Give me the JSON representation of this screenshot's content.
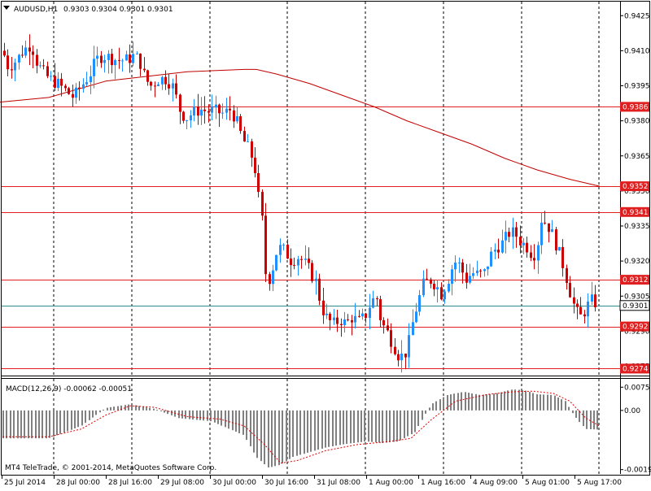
{
  "header": {
    "symbol_timeframe": "AUDUSD,H1",
    "ohlc": "0.9303 0.9304 0.9301 0.9301"
  },
  "footer": {
    "copyright": "MT4 TeleTrade, © 2001-2014, MetaQuotes Software Corp."
  },
  "colors": {
    "background": "#ffffff",
    "bull": "#1e90ff",
    "bear": "#cc0000",
    "level_line": "#e02020",
    "ma_line": "#c00000",
    "current_line": "#2e8b8b",
    "macd_hist": "#808080",
    "macd_signal": "#e00000",
    "grid_separator": "#000000"
  },
  "chart_data": [
    {
      "type": "candlestick",
      "title": "AUDUSD,H1",
      "ylim": [
        0.9271,
        0.9431
      ],
      "ticks": [
        "0.9425",
        "0.9410",
        "0.9395",
        "0.9380",
        "0.9365",
        "0.9350",
        "0.9335",
        "0.9320",
        "0.9305",
        "0.9290",
        "0.9275"
      ],
      "time_labels": [
        "25 Jul 2014",
        "28 Jul 00:00",
        "28 Jul 16:00",
        "29 Jul 08:00",
        "30 Jul 00:00",
        "30 Jul 16:00",
        "31 Jul 08:00",
        "1 Aug 00:00",
        "1 Aug 16:00",
        "4 Aug 09:00",
        "5 Aug 01:00",
        "5 Aug 17:00"
      ],
      "levels": [
        "0.9386",
        "0.9352",
        "0.9341",
        "0.9312",
        "0.9292",
        "0.9274"
      ],
      "current_price": "0.9301",
      "moving_average": [
        [
          0,
          0.9388
        ],
        [
          60,
          0.939
        ],
        [
          130,
          0.9397
        ],
        [
          180,
          0.9399
        ],
        [
          230,
          0.9401
        ],
        [
          300,
          0.9402
        ],
        [
          315,
          0.9402
        ],
        [
          340,
          0.94
        ],
        [
          380,
          0.9396
        ],
        [
          420,
          0.9391
        ],
        [
          460,
          0.9386
        ],
        [
          500,
          0.938
        ],
        [
          540,
          0.9375
        ],
        [
          580,
          0.937
        ],
        [
          620,
          0.9364
        ],
        [
          660,
          0.9359
        ],
        [
          700,
          0.9355
        ],
        [
          737,
          0.9352
        ]
      ],
      "candle_path": [
        [
          3,
          0.941
        ],
        [
          10,
          0.9403
        ],
        [
          20,
          0.9406
        ],
        [
          28,
          0.941
        ],
        [
          38,
          0.9413
        ],
        [
          45,
          0.9405
        ],
        [
          52,
          0.9401
        ],
        [
          60,
          0.9398
        ],
        [
          70,
          0.9396
        ],
        [
          80,
          0.9393
        ],
        [
          90,
          0.939
        ],
        [
          100,
          0.9395
        ],
        [
          110,
          0.94
        ],
        [
          118,
          0.9406
        ],
        [
          125,
          0.9408
        ],
        [
          135,
          0.9407
        ],
        [
          145,
          0.9406
        ],
        [
          155,
          0.9406
        ],
        [
          165,
          0.9408
        ],
        [
          172,
          0.9405
        ],
        [
          178,
          0.9398
        ],
        [
          185,
          0.9395
        ],
        [
          195,
          0.9398
        ],
        [
          205,
          0.9398
        ],
        [
          213,
          0.9394
        ],
        [
          220,
          0.9385
        ],
        [
          228,
          0.9381
        ],
        [
          235,
          0.9383
        ],
        [
          245,
          0.9385
        ],
        [
          255,
          0.9384
        ],
        [
          265,
          0.9384
        ],
        [
          275,
          0.9383
        ],
        [
          283,
          0.9385
        ],
        [
          290,
          0.938
        ],
        [
          298,
          0.9372
        ],
        [
          305,
          0.9368
        ],
        [
          312,
          0.9362
        ],
        [
          317,
          0.9348
        ],
        [
          322,
          0.9337
        ],
        [
          326,
          0.9315
        ],
        [
          332,
          0.9312
        ],
        [
          338,
          0.9323
        ],
        [
          345,
          0.9326
        ],
        [
          352,
          0.9323
        ],
        [
          358,
          0.932
        ],
        [
          365,
          0.9322
        ],
        [
          372,
          0.932
        ],
        [
          380,
          0.9316
        ],
        [
          388,
          0.9311
        ],
        [
          395,
          0.93
        ],
        [
          402,
          0.9295
        ],
        [
          410,
          0.9293
        ],
        [
          418,
          0.9295
        ],
        [
          425,
          0.9293
        ],
        [
          432,
          0.9296
        ],
        [
          440,
          0.9294
        ],
        [
          448,
          0.9296
        ],
        [
          455,
          0.9302
        ],
        [
          462,
          0.9305
        ],
        [
          468,
          0.9294
        ],
        [
          475,
          0.929
        ],
        [
          482,
          0.9285
        ],
        [
          489,
          0.928
        ],
        [
          496,
          0.9279
        ],
        [
          502,
          0.9285
        ],
        [
          508,
          0.9296
        ],
        [
          514,
          0.9303
        ],
        [
          520,
          0.931
        ],
        [
          528,
          0.9312
        ],
        [
          535,
          0.931
        ],
        [
          542,
          0.9306
        ],
        [
          550,
          0.9312
        ],
        [
          558,
          0.932
        ],
        [
          565,
          0.9318
        ],
        [
          572,
          0.9312
        ],
        [
          580,
          0.9315
        ],
        [
          588,
          0.9314
        ],
        [
          595,
          0.9315
        ],
        [
          602,
          0.9322
        ],
        [
          610,
          0.9326
        ],
        [
          618,
          0.9328
        ],
        [
          625,
          0.9332
        ],
        [
          632,
          0.9332
        ],
        [
          640,
          0.9328
        ],
        [
          648,
          0.9326
        ],
        [
          655,
          0.9322
        ],
        [
          660,
          0.9327
        ],
        [
          665,
          0.9338
        ],
        [
          672,
          0.9336
        ],
        [
          680,
          0.933
        ],
        [
          686,
          0.9324
        ],
        [
          692,
          0.9318
        ],
        [
          698,
          0.931
        ],
        [
          703,
          0.9303
        ],
        [
          708,
          0.9298
        ],
        [
          714,
          0.9296
        ],
        [
          720,
          0.93
        ],
        [
          726,
          0.9303
        ],
        [
          732,
          0.9302
        ],
        [
          737,
          0.9301
        ]
      ]
    },
    {
      "type": "bar",
      "title": "MACD(12,26,9) -0.00062 -0.00051",
      "ylim": [
        -0.00205,
        0.00102
      ],
      "ticks": [
        "0.0075",
        "0.00",
        "-0.00191"
      ],
      "histogram_path": [
        [
          3,
          -0.0009
        ],
        [
          60,
          -0.0009
        ],
        [
          100,
          -0.0005
        ],
        [
          130,
          8e-05
        ],
        [
          160,
          0.0002
        ],
        [
          190,
          5e-05
        ],
        [
          220,
          -0.00025
        ],
        [
          260,
          -0.00035
        ],
        [
          300,
          -0.0008
        ],
        [
          315,
          -0.0015
        ],
        [
          330,
          -0.00185
        ],
        [
          345,
          -0.00175
        ],
        [
          360,
          -0.0015
        ],
        [
          380,
          -0.00135
        ],
        [
          400,
          -0.0012
        ],
        [
          420,
          -0.0011
        ],
        [
          450,
          -0.001
        ],
        [
          470,
          -0.00105
        ],
        [
          490,
          -0.001
        ],
        [
          510,
          -0.0007
        ],
        [
          530,
          0.0002
        ],
        [
          550,
          0.0005
        ],
        [
          570,
          0.0006
        ],
        [
          590,
          0.0005
        ],
        [
          610,
          0.00055
        ],
        [
          630,
          0.00068
        ],
        [
          645,
          0.00065
        ],
        [
          660,
          0.00052
        ],
        [
          680,
          0.0005
        ],
        [
          695,
          0.0003
        ],
        [
          705,
          -0.00015
        ],
        [
          720,
          -0.0006
        ],
        [
          737,
          -0.00062
        ]
      ],
      "signal_path": [
        [
          3,
          -0.00085
        ],
        [
          60,
          -0.00085
        ],
        [
          100,
          -0.0006
        ],
        [
          130,
          -0.00015
        ],
        [
          160,
          0.00015
        ],
        [
          190,
          0.0001
        ],
        [
          230,
          -0.0002
        ],
        [
          270,
          -0.00028
        ],
        [
          300,
          -0.0005
        ],
        [
          325,
          -0.0011
        ],
        [
          345,
          -0.0017
        ],
        [
          365,
          -0.00162
        ],
        [
          400,
          -0.0013
        ],
        [
          440,
          -0.0011
        ],
        [
          480,
          -0.001
        ],
        [
          505,
          -0.0009
        ],
        [
          530,
          -0.0003
        ],
        [
          560,
          0.0003
        ],
        [
          600,
          0.00052
        ],
        [
          630,
          0.0006
        ],
        [
          655,
          0.00062
        ],
        [
          680,
          0.00055
        ],
        [
          700,
          0.0003
        ],
        [
          720,
          -0.00025
        ],
        [
          737,
          -0.00051
        ]
      ]
    }
  ]
}
